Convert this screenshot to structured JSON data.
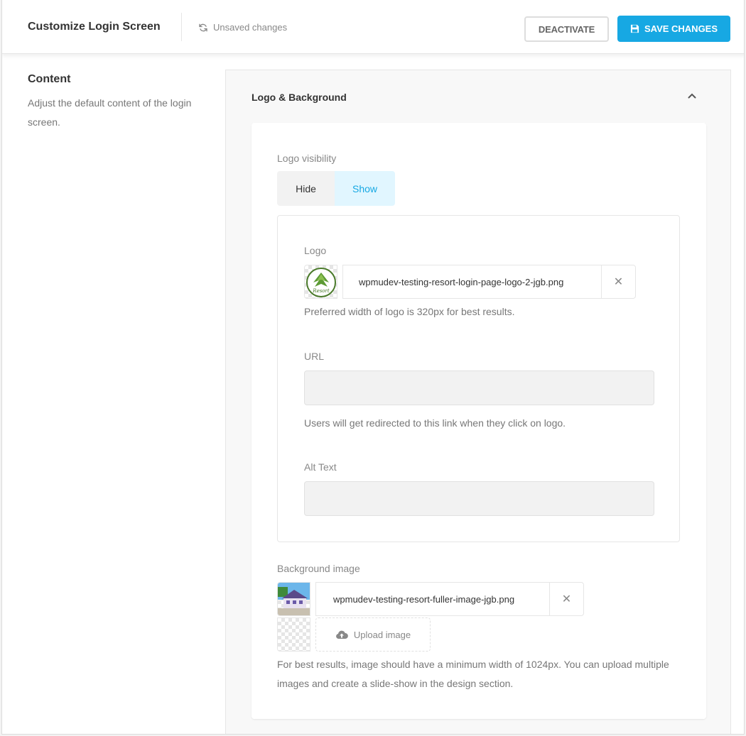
{
  "header": {
    "title": "Customize Login Screen",
    "status": "Unsaved changes",
    "deactivate_label": "DEACTIVATE",
    "save_label": "SAVE CHANGES"
  },
  "sidebar": {
    "title": "Content",
    "description": "Adjust the default content of the login screen."
  },
  "panel": {
    "title": "Logo & Background",
    "logo_visibility": {
      "label": "Logo visibility",
      "options": [
        "Hide",
        "Show"
      ],
      "selected": "Show"
    },
    "logo": {
      "label": "Logo",
      "file_name": "wpmudev-testing-resort-login-page-logo-2-jgb.png",
      "help": "Preferred width of logo is 320px for best results."
    },
    "url": {
      "label": "URL",
      "value": "",
      "help": "Users will get redirected to this link when they click on logo."
    },
    "alt_text": {
      "label": "Alt Text",
      "value": ""
    },
    "background": {
      "label": "Background image",
      "file_name": "wpmudev-testing-resort-fuller-image-jgb.png",
      "upload_label": "Upload image",
      "help": "For best results, image should have a minimum width of 1024px. You can upload multiple images and create a slide-show in the design section."
    }
  },
  "colors": {
    "accent": "#17a8e3",
    "toggle_active_bg": "#e1f6ff"
  },
  "icons": {
    "status": "refresh-icon",
    "save": "floppy-disk-icon",
    "collapse": "chevron-up-icon",
    "remove": "close-icon",
    "upload": "cloud-upload-icon"
  }
}
